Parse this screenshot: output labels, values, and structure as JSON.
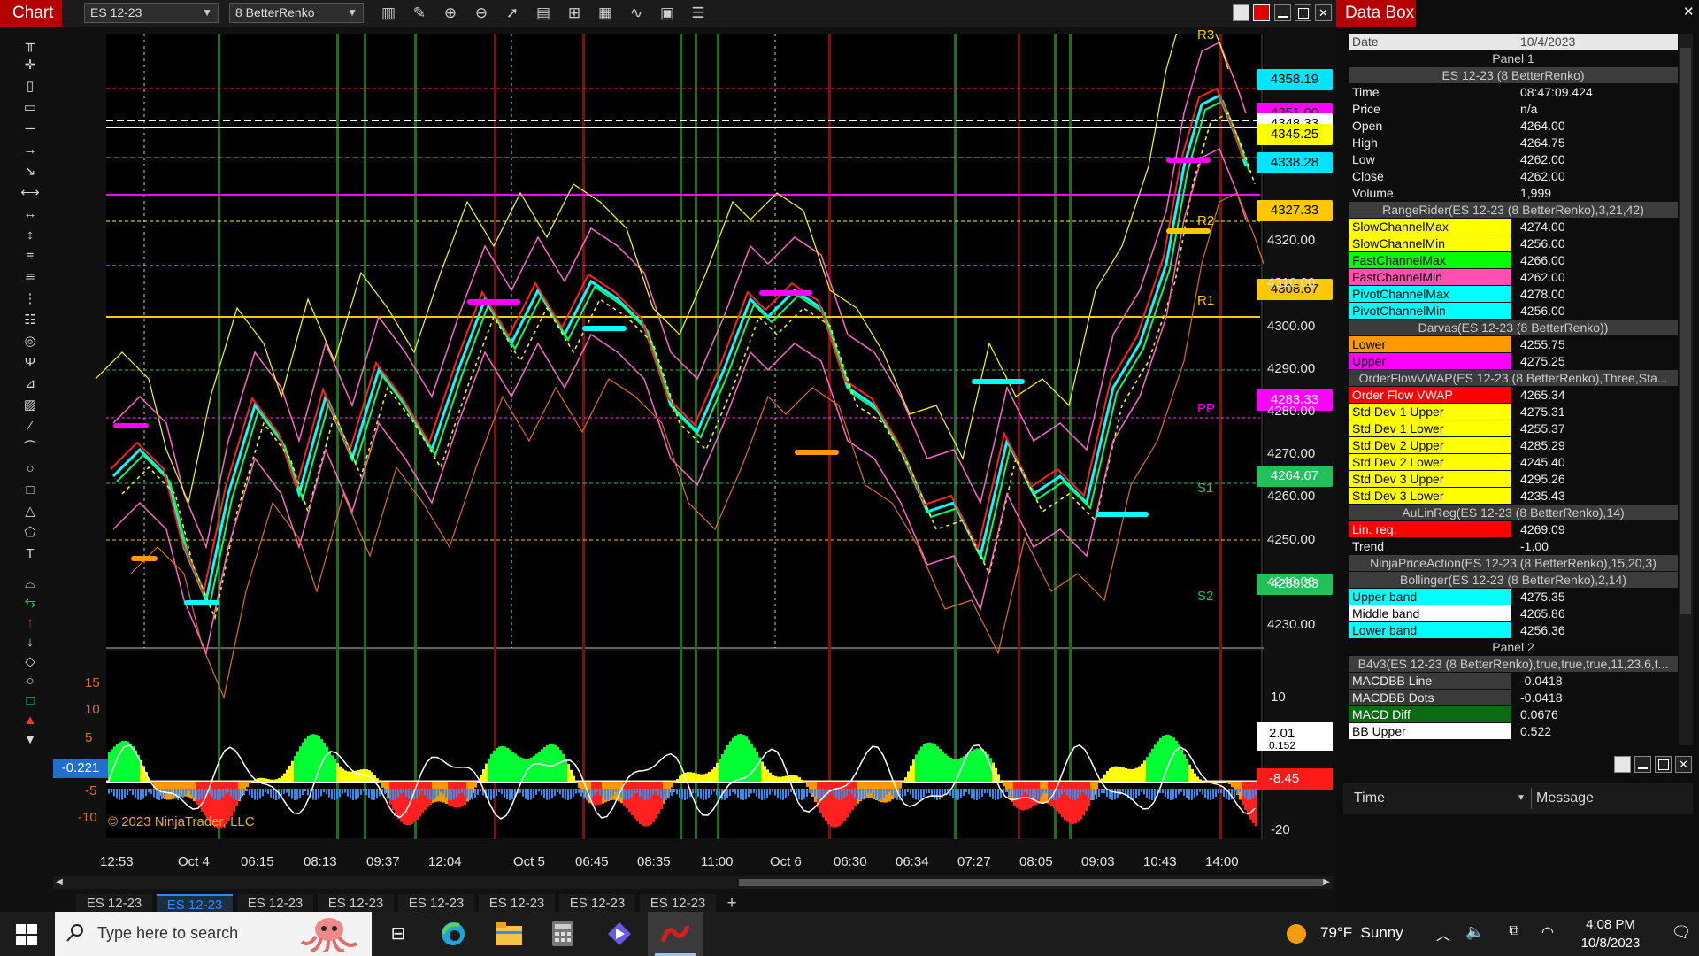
{
  "chart_window": {
    "title": "Chart",
    "instrument": "ES 12-23",
    "bar_type": "8 BetterRenko",
    "copyright": "© 2023 NinjaTrader, LLC",
    "toolbar_icons": [
      "bar-type-icon",
      "draw-pencil-icon",
      "zoom-in-icon",
      "zoom-out-icon",
      "cursor-icon",
      "data-series-icon",
      "template-icon",
      "indicators-icon",
      "strategies-icon",
      "properties-icon",
      "menu-list-icon"
    ],
    "draw_tools": [
      "ruler-icon",
      "crosshair-icon",
      "region-icon",
      "rect-icon",
      "line-icon",
      "ray-icon",
      "arrow-line-icon",
      "extended-line-icon",
      "horizontal-line-icon",
      "vertical-line-icon",
      "fib-retracement-icon",
      "fib-extension-icon",
      "fib-timezone-icon",
      "fib-circle-icon",
      "andrews-pitchfork-icon",
      "gann-fan-icon",
      "regression-channel-icon",
      "trend-channel-icon",
      "arc-icon",
      "ellipse-icon",
      "rectangle-icon",
      "triangle-icon",
      "polygon-icon",
      "text-icon",
      "path-icon",
      "risk-reward-icon",
      "arrow-up-icon",
      "arrow-down-icon",
      "diamond-icon",
      "dot-icon",
      "square-icon",
      "triangle-up-icon",
      "triangle-down-icon",
      "trash-icon"
    ],
    "price_axis": [
      "4230.00",
      "4240.00",
      "4250.00",
      "4260.00",
      "4270.00",
      "4280.00",
      "4290.00",
      "4300.00",
      "4310.00",
      "4320.00",
      "4330.00"
    ],
    "price_labels": [
      {
        "text": "4358.19",
        "bg": "#00e5ff",
        "fg": "#000"
      },
      {
        "text": "4351.00",
        "bg": "#ff00ff",
        "fg": "#000"
      },
      {
        "text": "4348.33",
        "bg": "#ffffff",
        "fg": "#000"
      },
      {
        "text": "4345.25",
        "bg": "#ffff00",
        "fg": "#000"
      },
      {
        "text": "4338.28",
        "bg": "#00e5ff",
        "fg": "#000"
      },
      {
        "text": "4327.33",
        "bg": "#ffc800",
        "fg": "#000"
      },
      {
        "text": "4308.67",
        "bg": "#ffc800",
        "fg": "#000"
      },
      {
        "text": "4283.33",
        "bg": "#ff00ff",
        "fg": "#fff"
      },
      {
        "text": "4264.67",
        "bg": "#22c05a",
        "fg": "#fff"
      },
      {
        "text": "4239.33",
        "bg": "#22c05a",
        "fg": "#fff"
      }
    ],
    "pivot_labels": [
      "R3",
      "R2",
      "R1",
      "PP",
      "S1",
      "S2"
    ],
    "panel2_axis_left": [
      "15",
      "10",
      "5",
      "-5",
      "-10"
    ],
    "panel2_axis_right": [
      "10",
      "-20"
    ],
    "panel2_value_left": "-0.221",
    "panel2_value_right_top": "2.01",
    "panel2_value_right_2": "0.152",
    "panel2_value_right_bottom": "-8.45",
    "time_axis": [
      "12:53",
      "Oct 4",
      "06:15",
      "08:13",
      "09:37",
      "12:04",
      "Oct 5",
      "06:45",
      "08:35",
      "11:00",
      "Oct 6",
      "06:30",
      "06:34",
      "07:27",
      "08:05",
      "09:03",
      "10:43",
      "14:00"
    ],
    "tabs": [
      "ES 12-23",
      "ES 12-23",
      "ES 12-23",
      "ES 12-23",
      "ES 12-23",
      "ES 12-23",
      "ES 12-23",
      "ES 12-23"
    ],
    "active_tab": 1,
    "add_tab": "+"
  },
  "databox": {
    "title": "Data Box",
    "date_label": "Date",
    "date_value": "10/4/2023",
    "panel1": "Panel 1",
    "series_header": "ES 12-23 (8 BetterRenko)",
    "ohlc": [
      {
        "k": "Time",
        "v": "08:47:09.424"
      },
      {
        "k": "Price",
        "v": "n/a"
      },
      {
        "k": "Open",
        "v": "4264.00"
      },
      {
        "k": "High",
        "v": "4264.75"
      },
      {
        "k": "Low",
        "v": "4262.00"
      },
      {
        "k": "Close",
        "v": "4262.00"
      },
      {
        "k": "Volume",
        "v": "1,999"
      }
    ],
    "rangerider_header": "RangeRider(ES 12-23 (8 BetterRenko),3,21,42)",
    "rangerider": [
      {
        "k": "SlowChannelMax",
        "v": "4274.00",
        "c": "#ffff00",
        "t": "#000"
      },
      {
        "k": "SlowChannelMin",
        "v": "4256.00",
        "c": "#ffff00",
        "t": "#000"
      },
      {
        "k": "FastChannelMax",
        "v": "4266.00",
        "c": "#00ff00",
        "t": "#000"
      },
      {
        "k": "FastChannelMin",
        "v": "4262.00",
        "c": "#ff4fb0",
        "t": "#000"
      },
      {
        "k": "PivotChannelMax",
        "v": "4278.00",
        "c": "#00ffff",
        "t": "#000"
      },
      {
        "k": "PivotChannelMin",
        "v": "4256.00",
        "c": "#00ffff",
        "t": "#000"
      }
    ],
    "darvas_header": "Darvas(ES 12-23 (8 BetterRenko))",
    "darvas": [
      {
        "k": "Lower",
        "v": "4255.75",
        "c": "#ff9900",
        "t": "#000"
      },
      {
        "k": "Upper",
        "v": "4275.25",
        "c": "#ff00ff",
        "t": "#000"
      }
    ],
    "vwap_header": "OrderFlowVWAP(ES 12-23 (8 BetterRenko),Three,Sta...",
    "vwap": [
      {
        "k": "Order Flow VWAP",
        "v": "4265.34",
        "c": "#ff0000",
        "t": "#fff"
      },
      {
        "k": "Std Dev 1 Upper",
        "v": "4275.31",
        "c": "#ffff00",
        "t": "#000"
      },
      {
        "k": "Std Dev 1 Lower",
        "v": "4255.37",
        "c": "#ffff00",
        "t": "#000"
      },
      {
        "k": "Std Dev 2 Upper",
        "v": "4285.29",
        "c": "#ffff00",
        "t": "#000"
      },
      {
        "k": "Std Dev 2 Lower",
        "v": "4245.40",
        "c": "#ffff00",
        "t": "#000"
      },
      {
        "k": "Std Dev 3 Upper",
        "v": "4295.26",
        "c": "#ffff00",
        "t": "#000"
      },
      {
        "k": "Std Dev 3 Lower",
        "v": "4235.43",
        "c": "#ffff00",
        "t": "#000"
      }
    ],
    "aulinreg_header": "AuLinReg(ES 12-23 (8 BetterRenko),14)",
    "aulinreg": [
      {
        "k": "Lin. reg.",
        "v": "4269.09",
        "c": "#ff0000",
        "t": "#fff"
      },
      {
        "k": "Trend",
        "v": "-1.00",
        "c": "transparent",
        "t": "#eee"
      }
    ],
    "npa_header": "NinjaPriceAction(ES 12-23 (8 BetterRenko),15,20,3)",
    "bollinger_header": "Bollinger(ES 12-23 (8 BetterRenko),2,14)",
    "bollinger": [
      {
        "k": "Upper band",
        "v": "4275.35",
        "c": "#00ffff",
        "t": "#000"
      },
      {
        "k": "Middle band",
        "v": "4265.86",
        "c": "#ffffff",
        "t": "#000"
      },
      {
        "k": "Lower band",
        "v": "4256.36",
        "c": "#00ffff",
        "t": "#000"
      }
    ],
    "panel2": "Panel 2",
    "b4v3_header": "B4v3(ES 12-23 (8 BetterRenko),true,true,true,11,23.6,t...",
    "b4v3": [
      {
        "k": "MACDBB Line",
        "v": "-0.0418",
        "c": "#3a3a3a",
        "t": "#eee"
      },
      {
        "k": "MACDBB Dots",
        "v": "-0.0418",
        "c": "#3a3a3a",
        "t": "#eee"
      },
      {
        "k": "MACD Diff",
        "v": "0.0676",
        "c": "#0b6b12",
        "t": "#fff"
      },
      {
        "k": "BB Upper",
        "v": "0.522",
        "c": "#ffffff",
        "t": "#000"
      }
    ]
  },
  "log": {
    "col_time": "Time",
    "col_message": "Message"
  },
  "taskbar": {
    "search_placeholder": "Type here to search",
    "weather": "79°F  Sunny",
    "time": "4:08 PM",
    "date": "10/8/2023"
  }
}
